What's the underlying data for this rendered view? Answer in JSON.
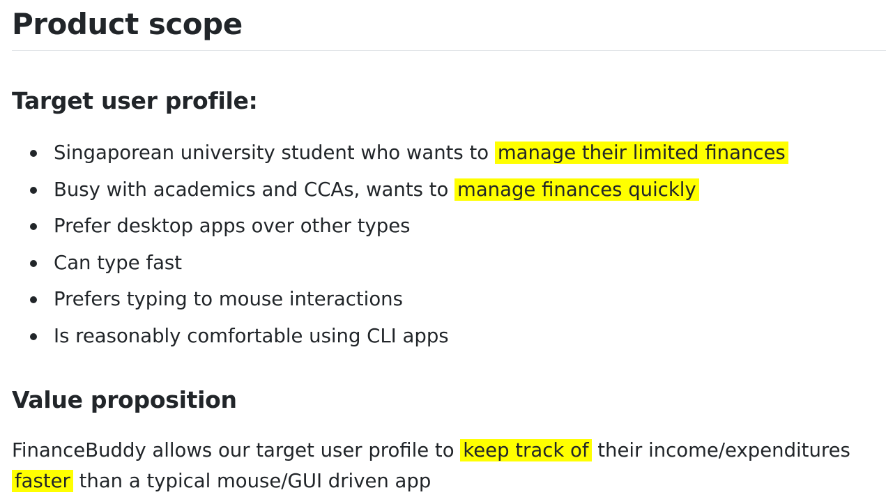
{
  "page": {
    "title": "Product scope"
  },
  "target_user": {
    "heading": "Target user profile:",
    "items": [
      {
        "text": "Singaporean university student who wants to ",
        "highlight": "manage their limited finances"
      },
      {
        "text": "Busy with academics and CCAs, wants to ",
        "highlight": "manage finances quickly"
      },
      {
        "text": "Prefer desktop apps over other types"
      },
      {
        "text": "Can type fast"
      },
      {
        "text": "Prefers typing to mouse interactions"
      },
      {
        "text": "Is reasonably comfortable using CLI apps"
      }
    ]
  },
  "value_proposition": {
    "heading": "Value proposition",
    "segments": {
      "s1": "FinanceBuddy allows our target user profile to ",
      "h1": "keep track of",
      "s2": " their income/expenditures ",
      "h2": "faster",
      "s3": " than a typical mouse/GUI driven app"
    }
  },
  "colors": {
    "highlight": "#ffff00",
    "text": "#212529",
    "divider": "#e1e4e8"
  }
}
